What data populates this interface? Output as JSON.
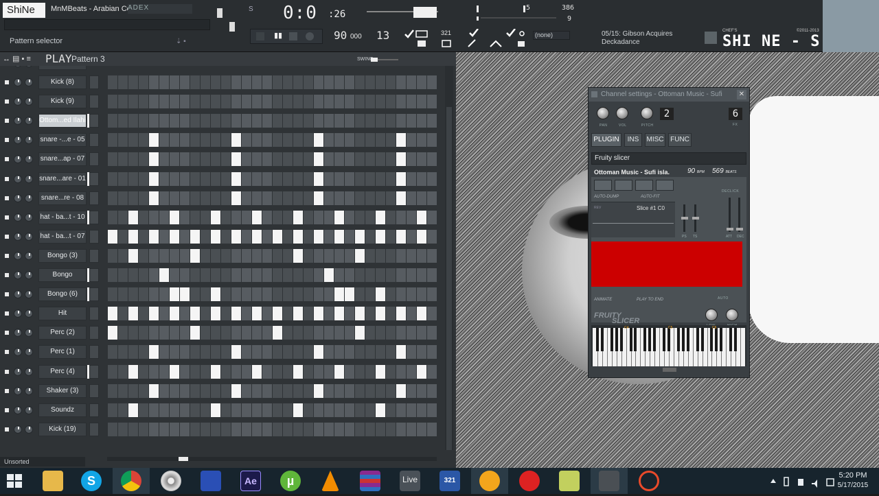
{
  "app": {
    "logo": "ShiNe",
    "file_title": "MnMBeats - Arabian Collabo.zip",
    "menu_strip": "ADEX",
    "pattern_selector_label": "Pattern selector"
  },
  "transport": {
    "time_main": "0:0",
    "time_sub": ":26",
    "song_marker": "S",
    "tempo": "90",
    "tempo_decimal": "000",
    "pattern_number": "13",
    "play_symbol": "▮▮"
  },
  "monitor": {
    "midi_value": "5",
    "cpu_value": "386",
    "poly_value": "9"
  },
  "tools": {
    "counter_label": "321",
    "output_select": "(none)"
  },
  "news": {
    "line1": "05/15: Gibson Acquires",
    "line2": "Deckadance"
  },
  "branding": {
    "shine_logo": "SHI NE - S! X",
    "shine_tag_left": "CHEF'S",
    "shine_tag_right": "©2011-2013"
  },
  "rack": {
    "play_label": "PLAY",
    "pattern_name": "Pattern 3",
    "swing_label": "SWING",
    "browser_filter": "Unsorted",
    "channels": [
      {
        "name": "Kick (8)",
        "steps": []
      },
      {
        "name": "Kick (9)",
        "steps": []
      },
      {
        "name": "Ottom...ed Ilahi",
        "steps": [],
        "selected": true
      },
      {
        "name": "snare -...e - 05",
        "steps": [
          4,
          12,
          20,
          28
        ]
      },
      {
        "name": "snare...ap - 07",
        "steps": [
          4,
          12,
          20,
          28
        ]
      },
      {
        "name": "snare...are - 01",
        "steps": [
          4,
          12,
          20,
          28
        ]
      },
      {
        "name": "snare...re - 08",
        "steps": [
          4,
          12,
          20,
          28
        ]
      },
      {
        "name": "hat - ba...t - 10",
        "steps": [
          2,
          6,
          10,
          14,
          18,
          22,
          26,
          30
        ]
      },
      {
        "name": "hat - ba...t - 07",
        "steps": [
          0,
          2,
          4,
          6,
          8,
          10,
          12,
          14,
          16,
          18,
          20,
          22,
          24,
          26,
          28,
          30
        ]
      },
      {
        "name": "Bongo (3)",
        "steps": [
          2,
          8,
          18,
          24
        ]
      },
      {
        "name": "Bongo",
        "steps": [
          5,
          21
        ]
      },
      {
        "name": "Bongo (6)",
        "steps": [
          6,
          7,
          10,
          22,
          23,
          26
        ]
      },
      {
        "name": "Hit",
        "steps": [
          0,
          2,
          4,
          6,
          8,
          10,
          12,
          14,
          16,
          18,
          20,
          22,
          24,
          26,
          28,
          30
        ]
      },
      {
        "name": "Perc (2)",
        "steps": [
          0,
          8,
          16,
          24
        ]
      },
      {
        "name": "Perc (1)",
        "steps": [
          4,
          12,
          20,
          28
        ]
      },
      {
        "name": "Perc (4)",
        "steps": [
          2,
          6,
          10,
          14,
          18,
          22,
          26,
          30
        ]
      },
      {
        "name": "Shaker (3)",
        "steps": [
          4,
          12,
          20,
          28
        ]
      },
      {
        "name": "Soundz",
        "steps": [
          2,
          10,
          18,
          26
        ]
      },
      {
        "name": "Kick (19)",
        "steps": []
      }
    ]
  },
  "channel_settings": {
    "title": "Channel settings - Ottoman Music - Sufi",
    "knob_labels": [
      "PAN",
      "VOL",
      "PITCH"
    ],
    "range_value": "2",
    "fx_value": "6",
    "fx_label": "FX",
    "tabs": [
      "PLUGIN",
      "INS",
      "MISC",
      "FUNC"
    ],
    "plugin_name": "Fruity slicer",
    "slicer": {
      "sample_name": "Ottoman Music - Sufi isla.",
      "bpm": "90",
      "bpm_unit": "BPM",
      "beats": "569",
      "beats_unit": "BEATS",
      "auto_dump": "AUTO-DUMP",
      "auto_fit": "AUTO-FIT",
      "slice_item": "Slice #1  C0",
      "rev_label": "REV",
      "declick_label": "DECLICK",
      "fader_labels": [
        "PS",
        "TS",
        "ATT",
        "DEC"
      ],
      "wave_color": "#cc0000",
      "animate": "ANIMATE",
      "play_to_end": "PLAY TO END",
      "auto_label": "AUTO",
      "logo_line1": "FRUITY",
      "logo_line2": "SLICER",
      "low_label": "LOW",
      "high_label": "HIGH"
    },
    "keyboard_octaves": [
      "C4",
      "C5",
      "C6"
    ]
  },
  "taskbar": {
    "live_label": "Live",
    "counter_icon_label": "321",
    "clock_time": "5:20 PM",
    "clock_date": "5/17/2015",
    "icons": [
      "windows-icon",
      "file-explorer-icon",
      "skype-icon",
      "chrome-icon",
      "media-player-icon",
      "save-disk-icon",
      "after-effects-icon",
      "utorrent-icon",
      "vlc-icon",
      "winrar-icon",
      "ableton-live-icon",
      "media-player-classic-icon",
      "fl-studio-icon",
      "red-app-icon",
      "notes-icon",
      "tool-app-icon",
      "sync-app-icon"
    ]
  },
  "colors": {
    "rack_bg": "#2f3336",
    "step_off": "#4a4f53",
    "step_on": "#f5f5f5",
    "taskbar": "#17242d",
    "slicer_wave": "#cc0000",
    "accent": "#f5a623"
  }
}
